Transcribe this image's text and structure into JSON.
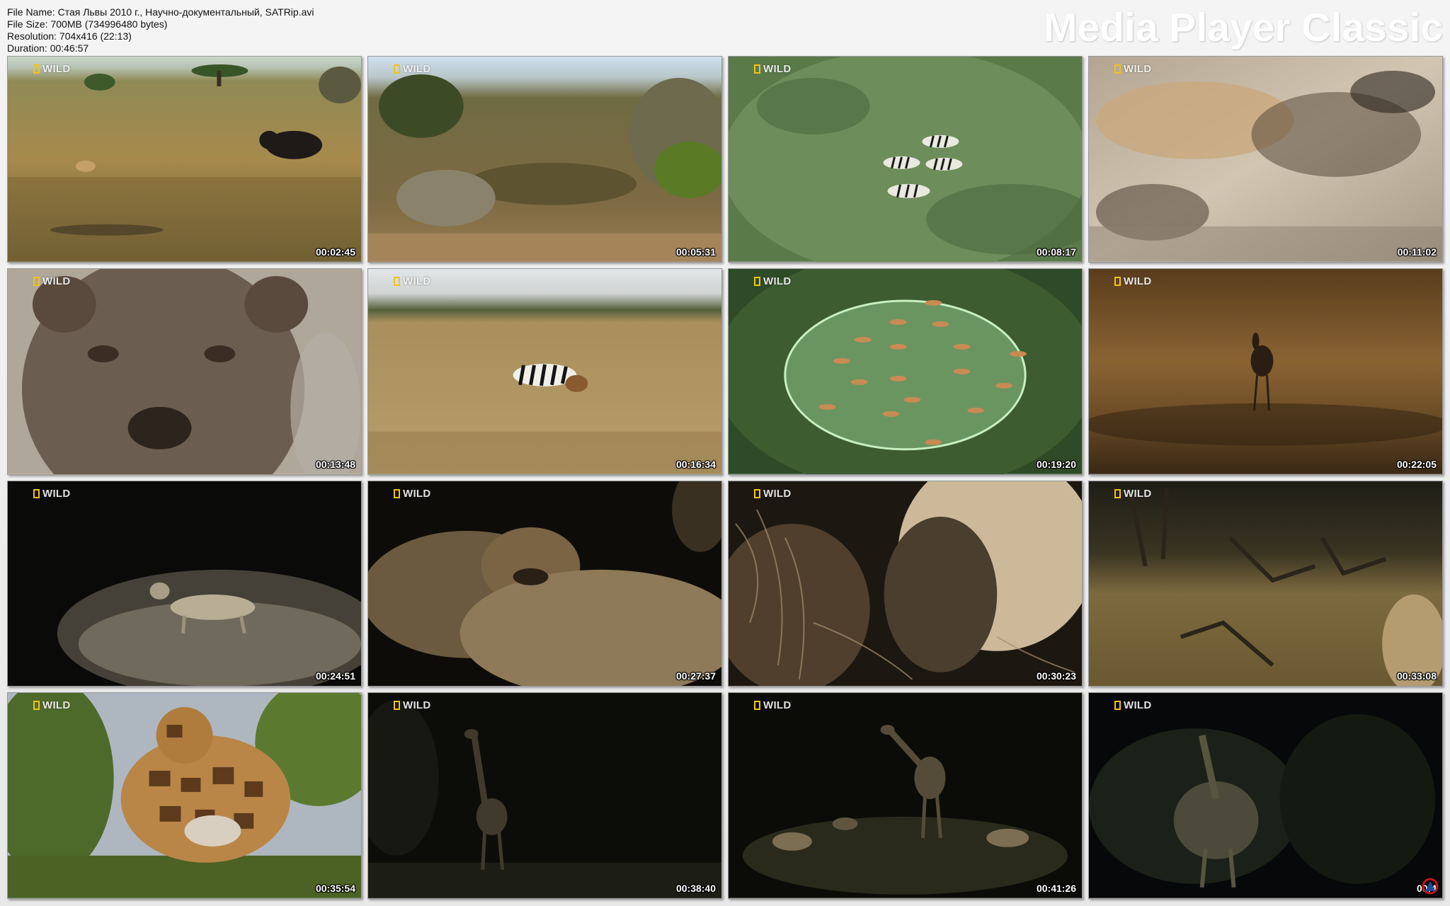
{
  "header": {
    "file_name": "File Name: Стая Львы 2010 г., Научно-документальный, SATRip.avi",
    "file_size": "File Size: 700MB (734996480 bytes)",
    "resolution": "Resolution: 704x416 (22:13)",
    "duration": "Duration: 00:46:57",
    "brand": "Media Player Classic"
  },
  "channel_logo": "WILD",
  "colors": {
    "logo_frame": "#f1c21b",
    "brand_text": "#ffffff"
  },
  "thumbnails": [
    {
      "timestamp": "00:02:45"
    },
    {
      "timestamp": "00:05:31"
    },
    {
      "timestamp": "00:08:17"
    },
    {
      "timestamp": "00:11:02"
    },
    {
      "timestamp": "00:13:48"
    },
    {
      "timestamp": "00:16:34"
    },
    {
      "timestamp": "00:19:20"
    },
    {
      "timestamp": "00:22:05"
    },
    {
      "timestamp": "00:24:51"
    },
    {
      "timestamp": "00:27:37"
    },
    {
      "timestamp": "00:30:23"
    },
    {
      "timestamp": "00:33:08"
    },
    {
      "timestamp": "00:35:54"
    },
    {
      "timestamp": "00:38:40"
    },
    {
      "timestamp": "00:41:26"
    },
    {
      "timestamp": "00:4"
    }
  ]
}
